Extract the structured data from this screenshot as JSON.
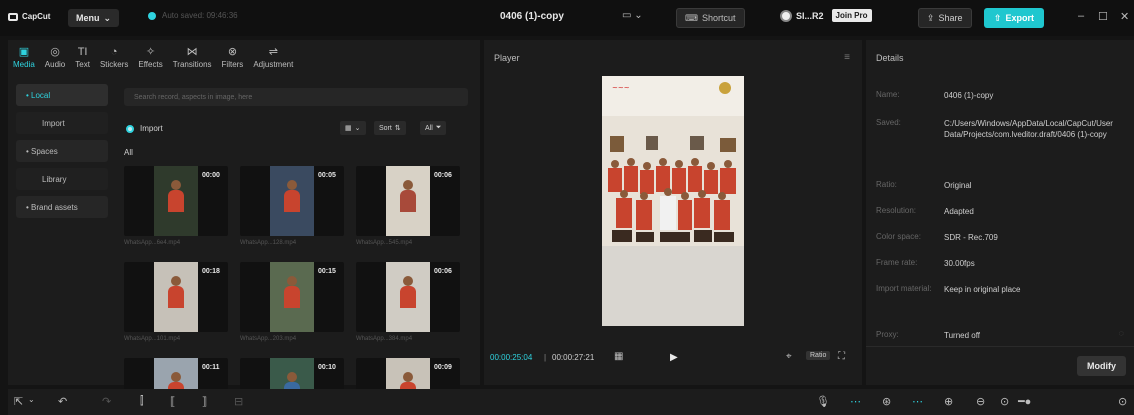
{
  "titlebar": {
    "app_name": "CapCut",
    "menu_label": "Menu",
    "autosave": "Auto saved: 09:46:36",
    "project_title": "0406 (1)-copy",
    "shortcut_label": "Shortcut",
    "user_name": "SI...R2",
    "join_pro": "Join Pro",
    "share_label": "Share",
    "export_label": "Export"
  },
  "tools": [
    {
      "label": "Media",
      "icon": "media-icon",
      "glyph": "▣",
      "active": true
    },
    {
      "label": "Audio",
      "icon": "audio-icon",
      "glyph": "◎",
      "active": false
    },
    {
      "label": "Text",
      "icon": "text-icon",
      "glyph": "TI",
      "active": false
    },
    {
      "label": "Stickers",
      "icon": "stickers-icon",
      "glyph": "◔",
      "active": false
    },
    {
      "label": "Effects",
      "icon": "effects-icon",
      "glyph": "✧",
      "active": false
    },
    {
      "label": "Transitions",
      "icon": "transitions-icon",
      "glyph": "⋈",
      "active": false
    },
    {
      "label": "Filters",
      "icon": "filters-icon",
      "glyph": "⊗",
      "active": false
    },
    {
      "label": "Adjustment",
      "icon": "adjustment-icon",
      "glyph": "⇌",
      "active": false
    }
  ],
  "sidenav": {
    "local": "• Local",
    "import": "Import",
    "spaces": "• Spaces",
    "library": "Library",
    "brand_assets": "• Brand assets"
  },
  "media": {
    "search_placeholder": "Search record, aspects in image, here",
    "import_label": "Import",
    "sort_label": "Sort",
    "filter_all": "All",
    "all_label": "All",
    "clips": [
      {
        "duration": "00:00",
        "name": "WhatsApp...6e4.mp4"
      },
      {
        "duration": "00:05",
        "name": "WhatsApp...128.mp4"
      },
      {
        "duration": "00:06",
        "name": "WhatsApp...545.mp4"
      },
      {
        "duration": "00:18",
        "name": "WhatsApp...101.mp4"
      },
      {
        "duration": "00:15",
        "name": "WhatsApp...203.mp4"
      },
      {
        "duration": "00:06",
        "name": "WhatsApp...384.mp4"
      },
      {
        "duration": "00:11",
        "name": ""
      },
      {
        "duration": "00:10",
        "name": ""
      },
      {
        "duration": "00:09",
        "name": ""
      }
    ]
  },
  "player": {
    "title": "Player",
    "current_time": "00:00:25:04",
    "total_time": "00:00:27:21",
    "ratio_label": "Ratio"
  },
  "details": {
    "title": "Details",
    "rows": [
      {
        "key": "Name:",
        "value": "0406 (1)-copy"
      },
      {
        "key": "Saved:",
        "value": "C:/Users/Windows/AppData/Local/CapCut/User Data/Projects/com.lveditor.draft/0406 (1)-copy"
      },
      {
        "key": "Ratio:",
        "value": "Original"
      },
      {
        "key": "Resolution:",
        "value": "Adapted"
      },
      {
        "key": "Color space:",
        "value": "SDR - Rec.709"
      },
      {
        "key": "Frame rate:",
        "value": "30.00fps"
      },
      {
        "key": "Import material:",
        "value": "Keep in original place"
      },
      {
        "key": "Proxy:",
        "value": "Turned off"
      }
    ],
    "modify_label": "Modify"
  },
  "colors": {
    "accent": "#2fd3df",
    "bg": "#141414",
    "panel": "#1c1c1c"
  }
}
